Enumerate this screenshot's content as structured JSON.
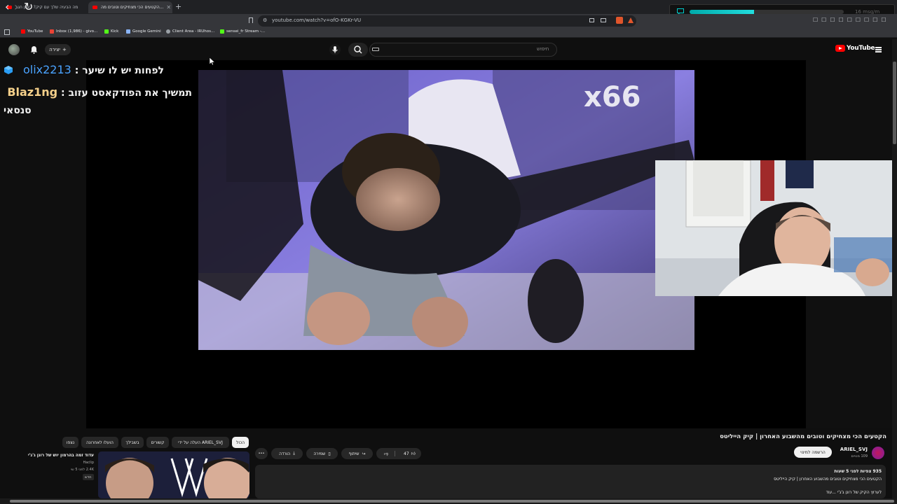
{
  "browser": {
    "tabs": [
      {
        "title": "מה הבעיה שלך עם קיק? ראיון חגב"
      },
      {
        "title": "הקטעים הכי מצחיקים וטובים מה..."
      }
    ],
    "url": "youtube.com/watch?v=ofO-KGKr-VU",
    "bookmarks": [
      {
        "label": "YouTube",
        "color": "#ff0000"
      },
      {
        "label": "Inbox (1,986) - givo...",
        "color": "#ea4335"
      },
      {
        "label": "Kick",
        "color": "#53fc18"
      },
      {
        "label": "Google Gemini",
        "color": "#8ab4f8"
      },
      {
        "label": "Client Area - IRUhos...",
        "color": "#9aa0a6"
      },
      {
        "label": "sensei_fr Stream -...",
        "color": "#53fc18"
      }
    ]
  },
  "chat_overlay": {
    "rate": "16 msg/m",
    "progress": 0.42
  },
  "youtube": {
    "search_placeholder": "חיפוש",
    "create_label": "יצירה",
    "logo_text": "YouTube",
    "video_title": "הקטעים הכי מצחיקים וטובים מהשבוע האחרון | קיק הייליטס",
    "channel": {
      "name": "ARIEL_SVJ",
      "subscribers": "109 מנויים",
      "subscribe_label": "הרשמה למינוי"
    },
    "actions": {
      "likes": "47",
      "share": "שיתוף",
      "save": "שמירה",
      "download": "הורדה",
      "more": "•••"
    },
    "description": {
      "stats": "935 צפיות  לפני 5 שעות",
      "line1": "הקטעים הכי מצחיקים וטובים מהשבוע האחרון | קיק הייליטס",
      "line2": "לערוץ הקיק של רונן ג'ג'י ...עוד"
    },
    "chips": [
      {
        "label": "הכול",
        "selected": true
      },
      {
        "label": "העלה על ידי ARIEL_SVJ",
        "selected": false
      },
      {
        "label": "קשורים",
        "selected": false
      },
      {
        "label": "בשבילך",
        "selected": false
      },
      {
        "label": "הועלו לאחרונה",
        "selected": false
      },
      {
        "label": "נצפו",
        "selected": false
      }
    ],
    "recommended": {
      "title": "עדוד זמה בהרמון יוש של רונן ג'ג'י",
      "channel": "Haclip",
      "meta": "2.4K  לפני 5 שי",
      "badge": "חדש"
    }
  },
  "stream_chat": [
    {
      "user": "olix2213",
      "message": "לפחות יש לו שיער",
      "user_color": "#4aa3ff"
    },
    {
      "user": "Blaz1ng",
      "message": "תמשיך את הפודקאסט עזוב",
      "user_color": "#f5d08a"
    },
    {
      "user": "",
      "message": "סנסאי",
      "user_color": "#ffffff"
    }
  ]
}
